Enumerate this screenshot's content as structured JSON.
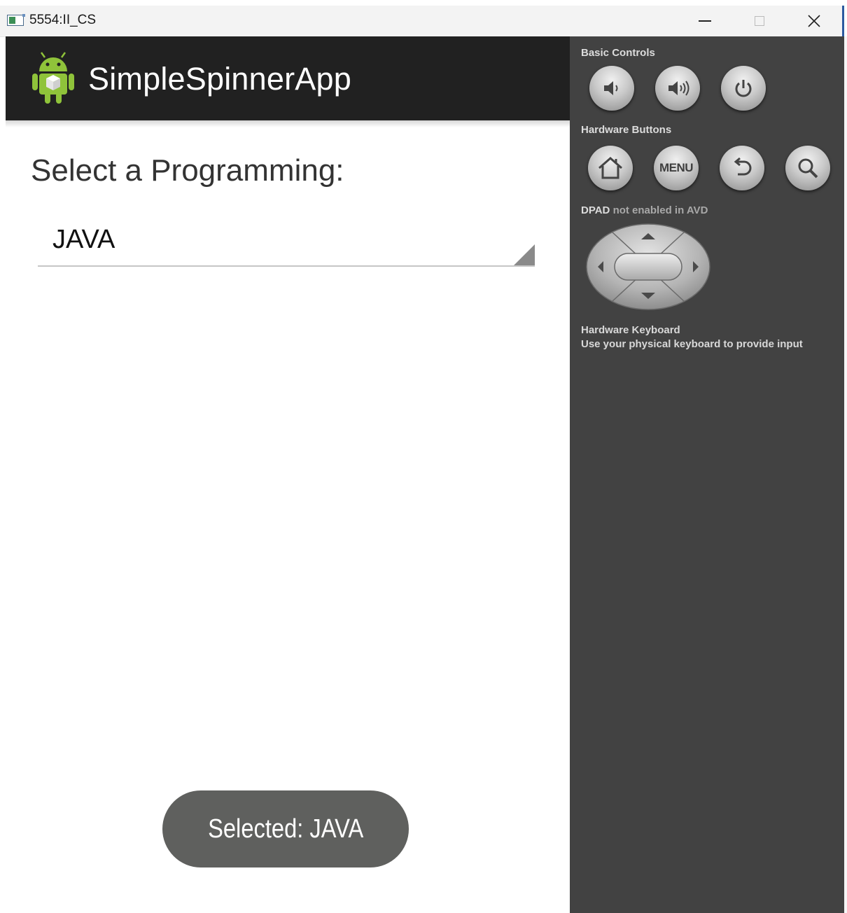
{
  "window": {
    "title": "5554:II_CS",
    "controls": [
      "minimize-icon",
      "maximize-icon",
      "close-icon"
    ]
  },
  "app": {
    "title": "SimpleSpinnerApp",
    "icon": "android-robot-icon",
    "action_bar_color": "#212121"
  },
  "main": {
    "prompt": "Select a Programming:",
    "spinner": {
      "selected": "JAVA",
      "icon": "spinner-dropdown-arrow-icon"
    }
  },
  "toast": {
    "text": "Selected: JAVA"
  },
  "emulator_panel": {
    "background": "#424242",
    "basic_controls": {
      "label": "Basic Controls",
      "buttons": [
        {
          "name": "volume-down",
          "icon": "volume-down-icon"
        },
        {
          "name": "volume-up",
          "icon": "volume-up-icon"
        },
        {
          "name": "power",
          "icon": "power-icon"
        }
      ]
    },
    "hardware_buttons": {
      "label": "Hardware Buttons",
      "buttons": [
        {
          "name": "home",
          "icon": "home-icon"
        },
        {
          "name": "menu",
          "label": "MENU"
        },
        {
          "name": "back",
          "icon": "back-arrow-icon"
        },
        {
          "name": "search",
          "icon": "search-icon"
        }
      ]
    },
    "dpad": {
      "label_bold": "DPAD",
      "label_rest": "not enabled in AVD"
    },
    "keyboard": {
      "title": "Hardware Keyboard",
      "description": "Use your physical keyboard to provide input"
    }
  }
}
